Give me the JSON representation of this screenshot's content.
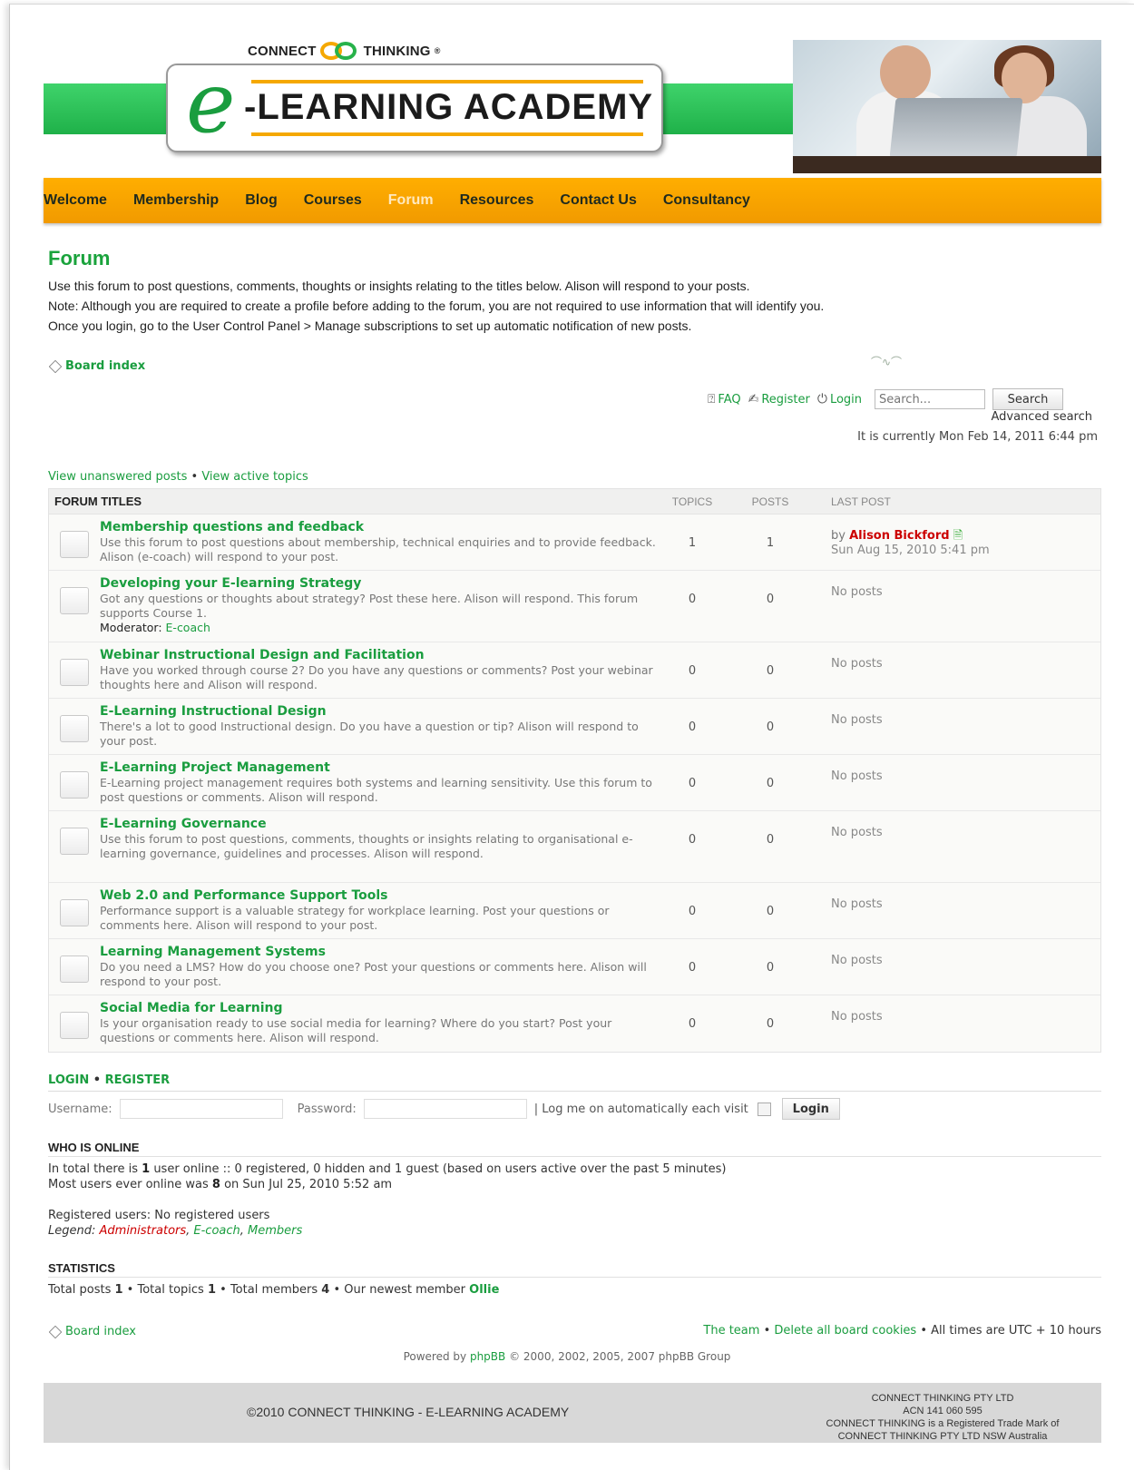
{
  "brand": {
    "top_name_left": "CONNECT",
    "top_name_right": "THINKING",
    "trademark": "®",
    "logo_letter": "e",
    "logo_text": "-LEARNING  ACADEMY"
  },
  "nav": {
    "items": [
      {
        "label": "Welcome",
        "active": false
      },
      {
        "label": "Membership",
        "active": false
      },
      {
        "label": "Blog",
        "active": false
      },
      {
        "label": "Courses",
        "active": false
      },
      {
        "label": "Forum",
        "active": true
      },
      {
        "label": "Resources",
        "active": false
      },
      {
        "label": "Contact Us",
        "active": false
      },
      {
        "label": "Consultancy",
        "active": false
      }
    ]
  },
  "intro": {
    "title": "Forum",
    "lines": [
      "Use this forum to post questions, comments, thoughts or insights relating to the titles below. Alison will respond to your posts.",
      "Note: Although you are required to create a profile before adding to the forum, you are not required to use information that will identify you.",
      "Once you login, go to the User Control Panel > Manage subscriptions to set up automatic notification of new posts."
    ]
  },
  "board_index": "Board index",
  "toplinks": {
    "faq": "FAQ",
    "register": "Register",
    "login": "Login",
    "search_placeholder": "Search...",
    "search_button": "Search",
    "advanced_search": "Advanced search",
    "current_time": "It is currently Mon Feb 14, 2011 6:44 pm"
  },
  "view_links": {
    "unanswered": "View unanswered posts",
    "separator": "•",
    "active": "View active topics"
  },
  "forum": {
    "headers": {
      "title": "FORUM TITLES",
      "topics": "TOPICS",
      "posts": "POSTS",
      "last_post": "LAST POST"
    },
    "rows": [
      {
        "title": "Membership questions and feedback",
        "desc": "Use this forum to post questions about membership, technical enquiries and to provide feedback. Alison (e-coach) will respond to your post.",
        "topics": "1",
        "posts": "1",
        "last_by": "by",
        "last_author": "Alison Bickford",
        "last_date": "Sun Aug 15, 2010 5:41 pm",
        "no_posts": ""
      },
      {
        "title": "Developing your E-learning Strategy",
        "desc": "Got any questions or thoughts about strategy? Post these here. Alison will respond. This forum supports Course 1.",
        "moderator_label": "Moderator:",
        "moderator": "E-coach",
        "topics": "0",
        "posts": "0",
        "no_posts": "No posts"
      },
      {
        "title": "Webinar Instructional Design and Facilitation",
        "desc": "Have you worked through course 2? Do you have any questions or comments? Post your webinar thoughts here and Alison will respond.",
        "topics": "0",
        "posts": "0",
        "no_posts": "No posts"
      },
      {
        "title": "E-Learning Instructional Design",
        "desc": "There's a lot to good Instructional design. Do you have a question or tip? Alison will respond to your post.",
        "topics": "0",
        "posts": "0",
        "no_posts": "No posts"
      },
      {
        "title": "E-Learning Project Management",
        "desc": "E-Learning project management requires both systems and learning sensitivity. Use this forum to post questions or comments. Alison will respond.",
        "topics": "0",
        "posts": "0",
        "no_posts": "No posts"
      },
      {
        "title": "E-Learning Governance",
        "desc": "Use this forum to post questions, comments, thoughts or insights relating to organisational e-learning governance, guidelines and processes. Alison will respond.",
        "topics": "0",
        "posts": "0",
        "no_posts": "No posts"
      },
      {
        "title": "Web 2.0 and Performance Support Tools",
        "desc": "Performance support is a valuable strategy for workplace learning. Post your questions or comments here. Alison will respond to your post.",
        "topics": "0",
        "posts": "0",
        "no_posts": "No posts"
      },
      {
        "title": "Learning Management Systems",
        "desc": "Do you need a LMS? How do you choose one? Post your questions or comments here. Alison will respond to your post.",
        "topics": "0",
        "posts": "0",
        "no_posts": "No posts"
      },
      {
        "title": "Social Media for Learning",
        "desc": "Is your organisation ready to use social media for learning? Where do you start? Post your questions or comments here. Alison will respond.",
        "topics": "0",
        "posts": "0",
        "no_posts": "No posts"
      }
    ]
  },
  "login": {
    "login_label": "LOGIN",
    "separator": "•",
    "register_label": "REGISTER",
    "username_label": "Username:",
    "password_label": "Password:",
    "auto_label": "| Log me on automatically each visit",
    "button": "Login"
  },
  "who_online": {
    "heading": "WHO IS ONLINE",
    "line1_a": "In total there is",
    "line1_count": "1",
    "line1_b": "user online :: 0 registered, 0 hidden and 1 guest (based on users active over the past 5 minutes)",
    "line2_a": "Most users ever online was",
    "line2_count": "8",
    "line2_b": "on Sun Jul 25, 2010 5:52 am",
    "registered": "Registered users: No registered users",
    "legend_label": "Legend:",
    "legend_admins": "Administrators",
    "legend_ecoach": "E-coach",
    "legend_members": "Members"
  },
  "statistics": {
    "heading": "STATISTICS",
    "posts_label": "Total posts",
    "posts": "1",
    "topics_label": "Total topics",
    "topics": "1",
    "members_label": "Total members",
    "members": "4",
    "newest_label": "Our newest member",
    "newest": "Ollie",
    "separator": "•"
  },
  "footer_links": {
    "board_index": "Board index",
    "team": "The team",
    "delete_cookies": "Delete all board cookies",
    "timezone": "All times are UTC + 10 hours",
    "separator": "•"
  },
  "powered": {
    "prefix": "Powered by",
    "phpbb": "phpBB",
    "suffix": "© 2000, 2002, 2005, 2007 phpBB Group"
  },
  "footer": {
    "copyright": "©2010 CONNECT THINKING - E-LEARNING ACADEMY",
    "company_lines": [
      "CONNECT THINKING PTY LTD",
      "ACN 141 060 595",
      "CONNECT THINKING is a Registered Trade Mark of",
      "CONNECT THINKING PTY LTD  NSW Australia"
    ]
  }
}
